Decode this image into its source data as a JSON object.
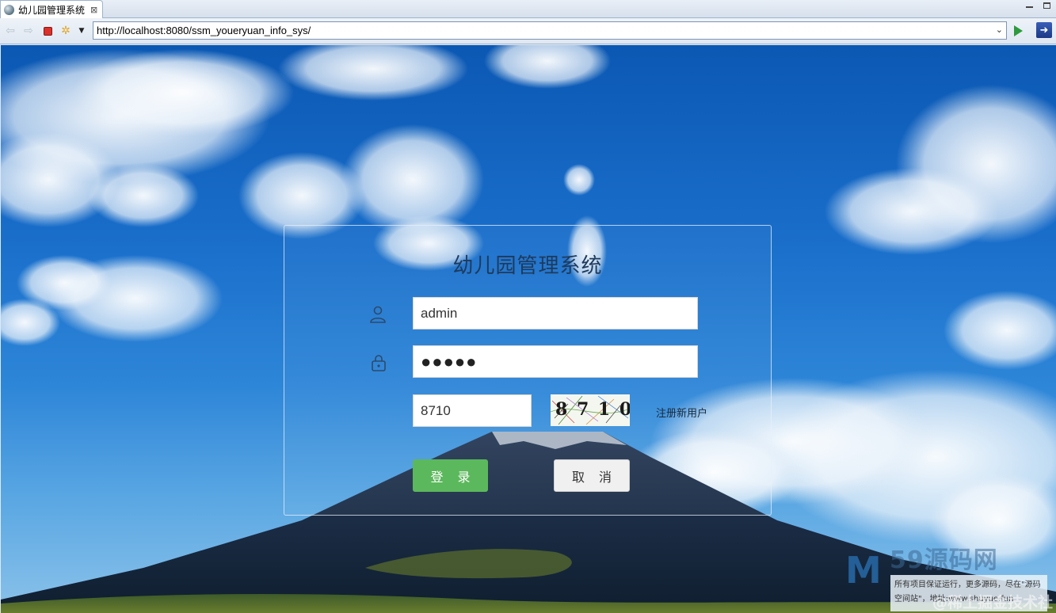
{
  "browser": {
    "tab_title": "幼儿园管理系统",
    "tab_close": "⊠",
    "url": "http://localhost:8080/ssm_youeryuan_info_sys/"
  },
  "login": {
    "title": "幼儿园管理系统",
    "username_value": "admin",
    "password_value": "●●●●●",
    "captcha_input_value": "8710",
    "captcha_image_text": "8 7 1 0",
    "register_link": "注册新用户",
    "login_button": "登录",
    "cancel_button": "取消"
  },
  "watermark": {
    "logo": "59源码网",
    "line1": "所有项目保证运行，更多源码，尽在\"源码",
    "line2": "空间站\"，地址:www.shuyue.fun",
    "corner": "@稀土掘金技术社区"
  },
  "colors": {
    "login_button": "#5cb85c",
    "cancel_button": "#f0f0f0",
    "title_text": "#1e3a5c"
  }
}
